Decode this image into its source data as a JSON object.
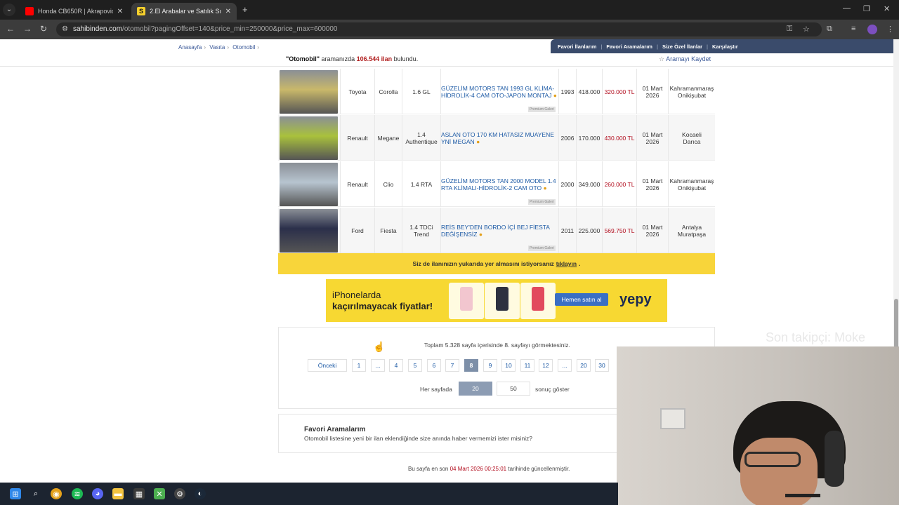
{
  "browser": {
    "tabs": [
      {
        "title": "Honda CB650R | Akrapovic Pur",
        "favicon_color": "#ff0000"
      },
      {
        "title": "2.El Arabalar ve Satılık Sıfır Km",
        "favicon_color": "#f7d02c",
        "favicon_letter": "S"
      }
    ],
    "new_tab_label": "+",
    "url_host": "sahibinden.com",
    "url_path": "/otomobil?pagingOffset=140&price_min=250000&price_max=600000"
  },
  "breadcrumb": [
    "Anasayfa",
    "Vasıta",
    "Otomobil"
  ],
  "topnav": [
    "Favori İlanlarım",
    "Favori Aramalarım",
    "Size Özel İlanlar",
    "Karşılaştır"
  ],
  "result_summary": {
    "query": "\"Otomobil\"",
    "middle": "aramanızda",
    "count": "106.544 ilan",
    "suffix": "bulundu."
  },
  "save_search_label": "Aramayı Kaydet",
  "listings": [
    {
      "brand": "Toyota",
      "model": "Corolla",
      "engine": "1.6 GL",
      "title": "GÜZELİM MOTORS TAN 1993 GL KLİMA-HİDROLİK-4 CAM OTO-JAPON MONTAJ",
      "premium": "Premium Galeri",
      "year": "1993",
      "km": "418.000",
      "price": "320.000 TL",
      "date_line1": "01 Mart",
      "date_line2": "2026",
      "loc_line1": "Kahramanmaraş",
      "loc_line2": "Onikişubat",
      "photo_color": "#c9b86a"
    },
    {
      "brand": "Renault",
      "model": "Megane",
      "engine": "1.4 Authentique",
      "title": "ASLAN OTO 170 KM HATASIZ MUAYENE YNİ MEGAN",
      "premium": "",
      "year": "2006",
      "km": "170.000",
      "price": "430.000 TL",
      "date_line1": "01 Mart",
      "date_line2": "2026",
      "loc_line1": "Kocaeli",
      "loc_line2": "Darıca",
      "photo_color": "#a9c13c"
    },
    {
      "brand": "Renault",
      "model": "Clio",
      "engine": "1.4 RTA",
      "title": "GÜZELİM MOTORS TAN 2000 MODEL 1.4 RTA KLİMALI-HİDROLİK-2 CAM OTO",
      "premium": "Premium Galeri",
      "year": "2000",
      "km": "349.000",
      "price": "260.000 TL",
      "date_line1": "01 Mart",
      "date_line2": "2026",
      "loc_line1": "Kahramanmaraş",
      "loc_line2": "Onikişubat",
      "photo_color": "#b7c4cf"
    },
    {
      "brand": "Ford",
      "model": "Fiesta",
      "engine": "1.4 TDCi Trend",
      "title": "REİS BEY'DEN BORDO İÇİ BEJ FİESTA DEĞİŞENSİZ",
      "premium": "Premium Galeri",
      "year": "2011",
      "km": "225.000",
      "price": "569.750 TL",
      "date_line1": "01 Mart",
      "date_line2": "2026",
      "loc_line1": "Antalya",
      "loc_line2": "Muratpaşa",
      "photo_color": "#2b2f4a"
    }
  ],
  "promo": {
    "text": "Siz de ilanınızın yukarıda yer almasını istiyorsanız",
    "link": "tıklayın",
    "end": "."
  },
  "ad": {
    "line1": "iPhonelarda",
    "line2": "kaçırılmayacak fiyatlar!",
    "phones": [
      {
        "model": "iPhone 11",
        "color": "#f2c6cf"
      },
      {
        "model": "iPhone 12",
        "color": "#2d3140"
      },
      {
        "model": "iPhone 13",
        "color": "#e24a5d"
      }
    ],
    "cta": "Hemen satın al",
    "brand": "yepy"
  },
  "pager": {
    "info": "Toplam 5.328 sayfa içerisinde 8. sayfayı görmektesiniz.",
    "prev": "Önceki",
    "pages": [
      "1",
      "...",
      "4",
      "5",
      "6",
      "7",
      "8",
      "9",
      "10",
      "11",
      "12",
      "...",
      "20",
      "30"
    ],
    "active": "8",
    "per_page_label": "Her sayfada",
    "per_page_options": [
      "20",
      "50"
    ],
    "per_page_active": "20",
    "per_page_suffix": "sonuç göster"
  },
  "favorites": {
    "heading": "Favori Aramalarım",
    "desc": "Otomobil listesine yeni bir ilan eklendiğinde size anında haber vermemizi ister misiniz?"
  },
  "updated": {
    "prefix": "Bu sayfa en son",
    "date": "04 Mart 2026 00:25:01",
    "suffix": "tarihinde güncellenmiştir."
  },
  "overlay_text": "Son takipçi: Moke",
  "taskbar_icons": [
    "windows-icon",
    "search-icon",
    "chrome-icon",
    "spotify-icon",
    "discord-icon",
    "folder-icon",
    "store-icon",
    "xbox-icon",
    "settings-icon",
    "steam-icon"
  ]
}
